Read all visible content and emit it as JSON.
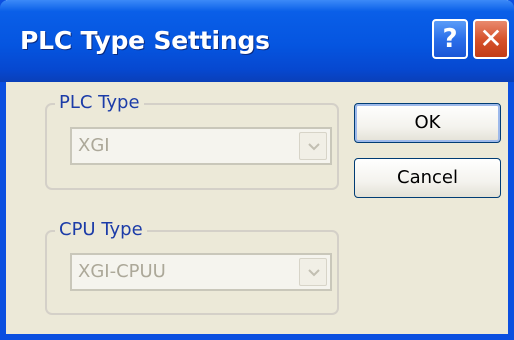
{
  "dialog": {
    "title": "PLC Type Settings",
    "help_button": "?",
    "close_button": "✕"
  },
  "plc_type": {
    "label": "PLC Type",
    "value": "XGI",
    "enabled": false
  },
  "cpu_type": {
    "label": "CPU Type",
    "value": "XGI-CPUU",
    "enabled": false
  },
  "buttons": {
    "ok": "OK",
    "cancel": "Cancel"
  },
  "icons": {
    "help": "question-mark-icon",
    "close": "close-x-icon",
    "dropdown": "chevron-down-icon"
  },
  "colors": {
    "titlebar": "#0555E0",
    "dialog_bg": "#ECE9D8",
    "close_button": "#D7532D",
    "group_label": "#1C3CA8",
    "disabled_text": "#ACA899"
  }
}
